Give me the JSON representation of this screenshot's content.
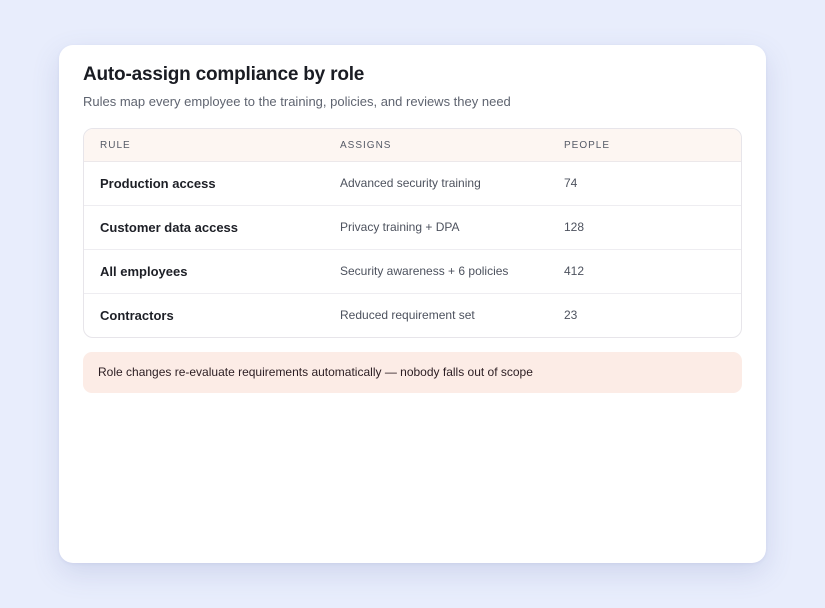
{
  "card": {
    "title": "Auto-assign compliance by role",
    "subtitle": "Rules map every employee to the training, policies, and reviews they need"
  },
  "table": {
    "columns": [
      "RULE",
      "ASSIGNS",
      "PEOPLE"
    ],
    "rows": [
      {
        "rule": "Production access",
        "assigns": "Advanced security training",
        "people": "74"
      },
      {
        "rule": "Customer data access",
        "assigns": "Privacy training + DPA",
        "people": "128"
      },
      {
        "rule": "All employees",
        "assigns": "Security awareness + 6 policies",
        "people": "412"
      },
      {
        "rule": "Contractors",
        "assigns": "Reduced requirement set",
        "people": "23"
      }
    ]
  },
  "note": {
    "text": "Role changes re-evaluate requirements automatically — nobody falls out of scope"
  },
  "colors": {
    "background": "#e8edfc",
    "card": "#ffffff",
    "table_header": "#fdf6f2",
    "note_background": "#fcece6"
  }
}
